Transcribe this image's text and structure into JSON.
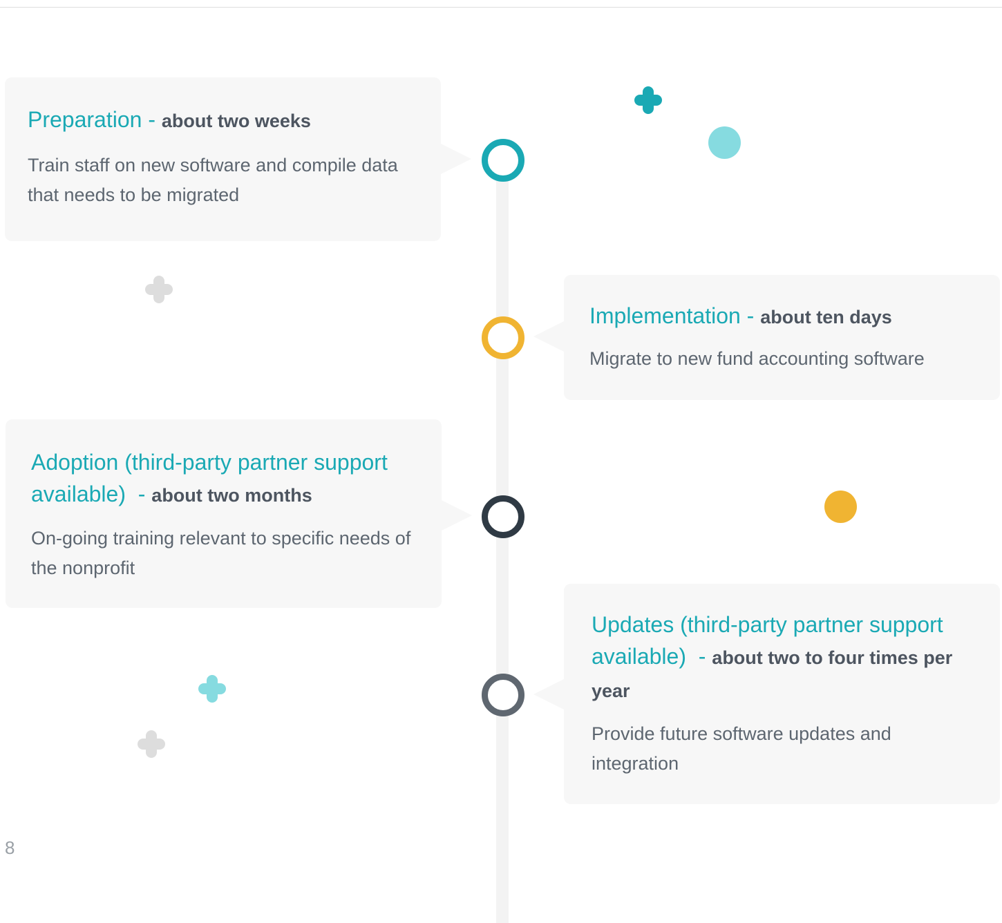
{
  "page_number": "8",
  "colors": {
    "teal": "#1aa9b4",
    "light_teal": "#86dbe0",
    "amber": "#f0b432",
    "dark_slate": "#2f3a44",
    "slate": "#5f6770",
    "light_gray": "#dddddd"
  },
  "steps": [
    {
      "title": "Preparation",
      "separator": " - ",
      "duration": "about two weeks",
      "description": "Train staff on new software and compile data that needs to be migrated",
      "node_color": "teal"
    },
    {
      "title": "Implementation",
      "separator": " - ",
      "duration": "about ten days",
      "description": "Migrate to new fund accounting software",
      "node_color": "amber"
    },
    {
      "title": "Adoption (third-party partner support available)",
      "separator": "  - ",
      "duration": "about two months",
      "description": "On-going training relevant to specific needs of the nonprofit",
      "node_color": "dark_slate"
    },
    {
      "title": "Updates (third-party partner support available)",
      "separator": "  - ",
      "duration": "about two to four times per year",
      "description": "Provide future software updates and integration",
      "node_color": "slate"
    }
  ],
  "decorations": [
    {
      "shape": "plus-icon",
      "color": "teal"
    },
    {
      "shape": "circle",
      "color": "light_teal"
    },
    {
      "shape": "plus-icon",
      "color": "light_gray"
    },
    {
      "shape": "circle",
      "color": "amber"
    },
    {
      "shape": "plus-icon",
      "color": "light_teal"
    },
    {
      "shape": "plus-icon",
      "color": "light_gray"
    }
  ]
}
